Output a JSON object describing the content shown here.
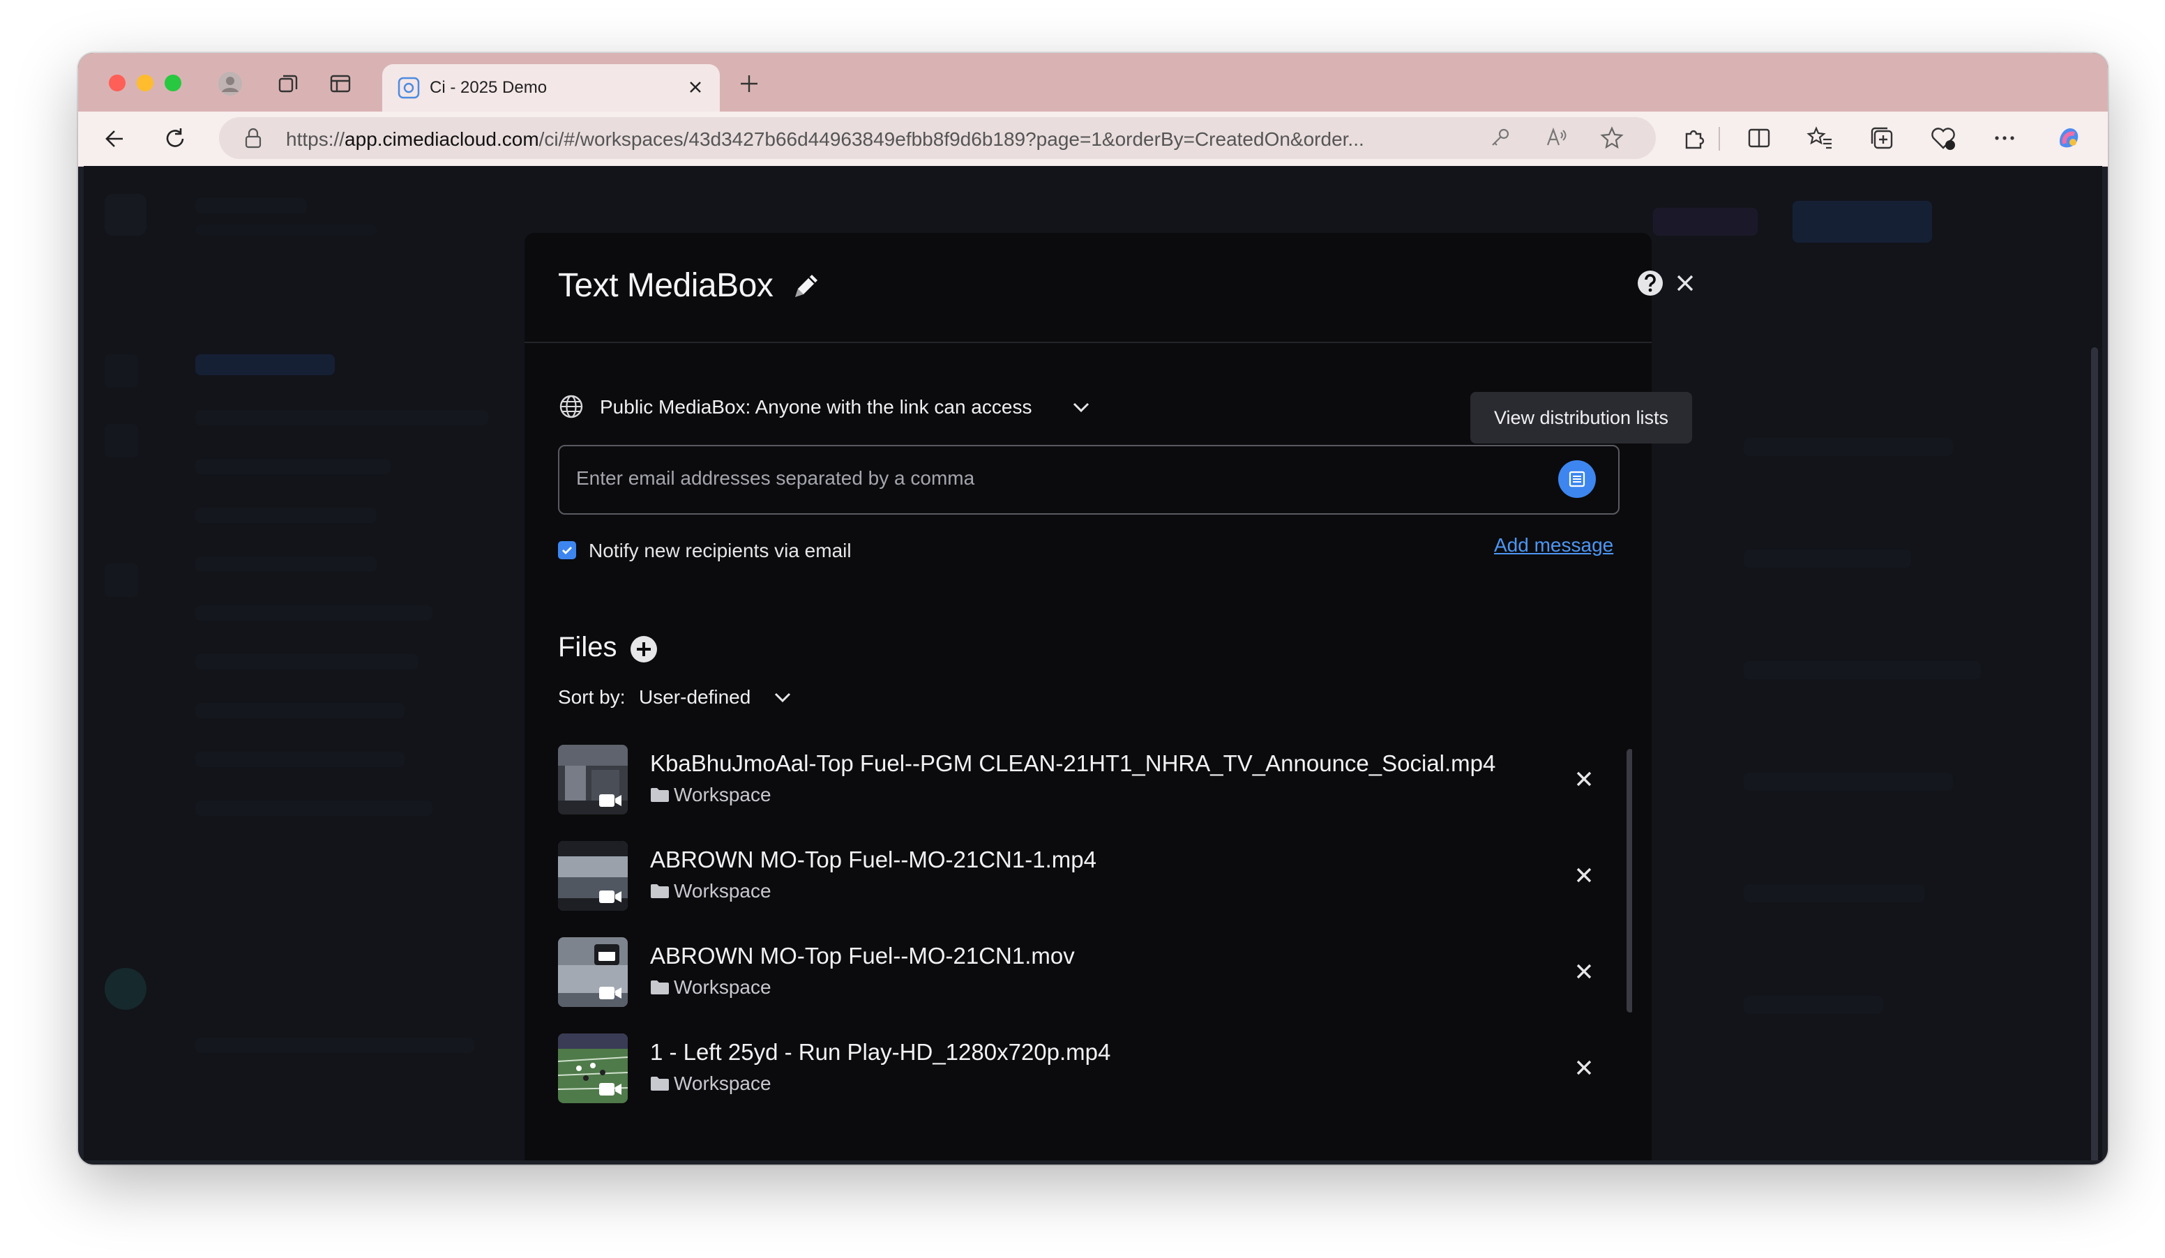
{
  "browser": {
    "tab_title": "Ci - 2025 Demo",
    "url_prefix": "https://",
    "url_host": "app.cimediacloud.com",
    "url_rest": "/ci/#/workspaces/43d3427b66d44963849efbb8f9d6b189?page=1&orderBy=CreatedOn&order..."
  },
  "modal": {
    "title": "Text MediaBox",
    "access_label": "Public MediaBox: Anyone with the link can access",
    "tooltip": "View distribution lists",
    "email_placeholder": "Enter email addresses separated by a comma",
    "notify_label": "Notify new recipients via email",
    "notify_checked": true,
    "add_message": "Add message",
    "files_title": "Files",
    "sort_label": "Sort by:",
    "sort_value": "User-defined",
    "files": [
      {
        "name": "KbaBhuJmoAal-Top Fuel--PGM CLEAN-21HT1_NHRA_TV_Announce_Social.mp4",
        "folder": "Workspace"
      },
      {
        "name": "ABROWN MO-Top Fuel--MO-21CN1-1.mp4",
        "folder": "Workspace"
      },
      {
        "name": "ABROWN MO-Top Fuel--MO-21CN1.mov",
        "folder": "Workspace"
      },
      {
        "name": "1 - Left 25yd - Run Play-HD_1280x720p.mp4",
        "folder": "Workspace"
      }
    ]
  },
  "colors": {
    "accent": "#3d86f0",
    "link": "#4c96f5",
    "modal_bg": "#0b0b0d",
    "tabbar_bg": "#d9b3b3"
  }
}
